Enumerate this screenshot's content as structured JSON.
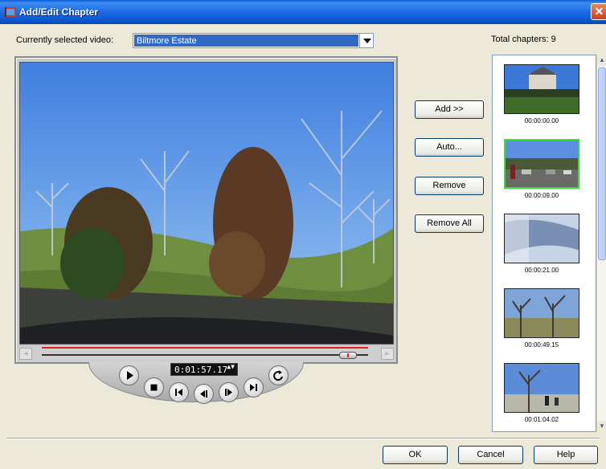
{
  "window": {
    "title": "Add/Edit Chapter",
    "close_glyph": "✕",
    "icon": "chapter-icon"
  },
  "video_select": {
    "label": "Currently selected video:",
    "value": "Biltmore  Estate"
  },
  "total_chapters_text": "Total chapters: 9",
  "player": {
    "timecode": "0:01:57.17",
    "scrub_left_glyph": "◄",
    "scrub_right_glyph": "►",
    "spin_glyph": "▲▼"
  },
  "actions": {
    "add": "Add >>",
    "auto": "Auto...",
    "remove": "Remove",
    "remove_all": "Remove All"
  },
  "chapters": [
    {
      "time": "00:00:00.00",
      "selected": false
    },
    {
      "time": "00:00:09.00",
      "selected": true
    },
    {
      "time": "00:00:21.00",
      "selected": false
    },
    {
      "time": "00:00:49.15",
      "selected": false
    },
    {
      "time": "00:01:04.02",
      "selected": false
    }
  ],
  "scroll": {
    "up_glyph": "▲",
    "down_glyph": "▼"
  },
  "footer": {
    "ok": "OK",
    "cancel": "Cancel",
    "help": "Help"
  },
  "colors": {
    "selection": "#316AC5",
    "selected_thumb_border": "#33E033",
    "timeline_red": "#E02020"
  }
}
